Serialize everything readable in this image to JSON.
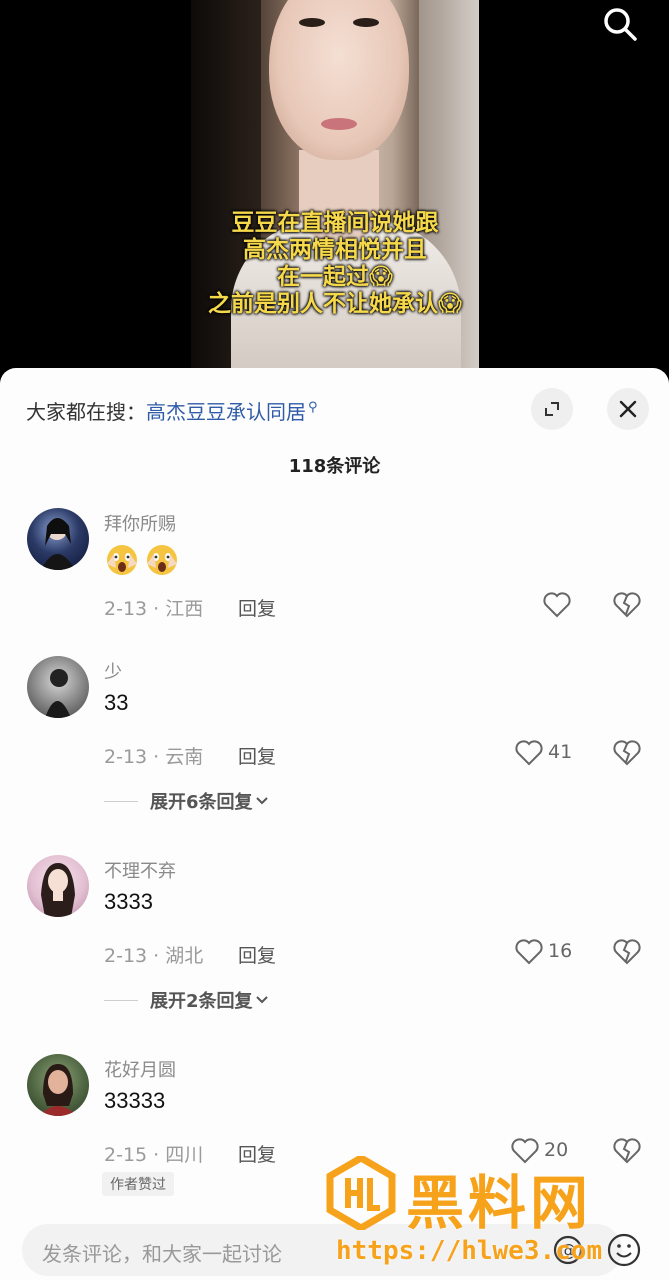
{
  "video": {
    "caption_lines": [
      "豆豆在直播间说她跟",
      "高杰两情相悦并且",
      "在一起过😱",
      "之前是别人不让她承认😱"
    ]
  },
  "sheet": {
    "trend_prefix": "大家都在搜：",
    "trend_keyword": "高杰豆豆承认同居",
    "comment_count": "118条评论"
  },
  "comments": [
    {
      "user": "拜你所赐",
      "text": "",
      "emoji_count": 2,
      "emoji_icon": "shocked-face-icon",
      "meta": "2-13 · 江西",
      "reply": "回复",
      "likes": "",
      "expand": ""
    },
    {
      "user": "少",
      "text": "33",
      "meta": "2-13 · 云南",
      "reply": "回复",
      "likes": "41",
      "expand": "展开6条回复"
    },
    {
      "user": "不理不弃",
      "text": "3333",
      "meta": "2-13 · 湖北",
      "reply": "回复",
      "likes": "16",
      "expand": "展开2条回复"
    },
    {
      "user": "花好月圆",
      "text": "33333",
      "meta": "2-15 · 四川",
      "reply": "回复",
      "likes": "20",
      "expand": "",
      "badge": "作者赞过"
    }
  ],
  "input": {
    "placeholder": "发条评论，和大家一起讨论"
  },
  "watermark": {
    "title": "黑料网",
    "url": "https://hlwe3.com"
  },
  "colors": {
    "caption": "#f6d94a",
    "trend_keyword": "#2f5ba8",
    "watermark": "#f7a21b"
  }
}
